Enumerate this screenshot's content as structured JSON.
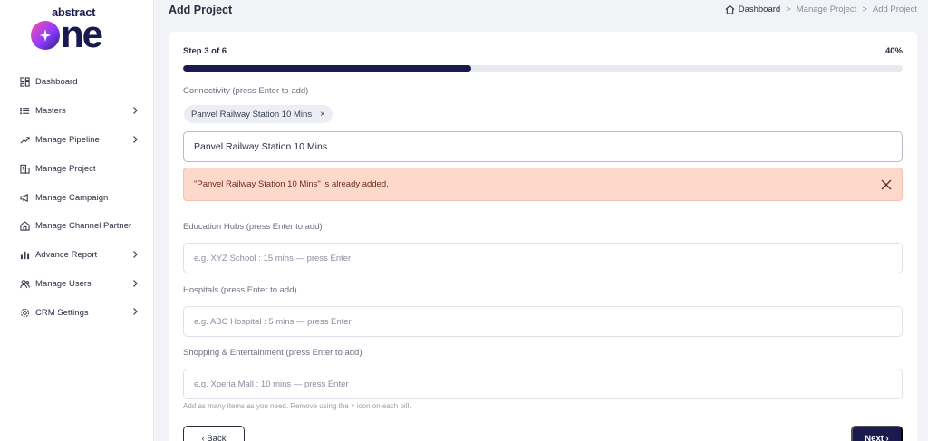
{
  "brand": {
    "top": "abstract",
    "main_o": "o",
    "main_rest": "ne"
  },
  "sidebar": {
    "items": [
      {
        "label": "Dashboard",
        "icon": "grid-icon",
        "has_submenu": false
      },
      {
        "label": "Masters",
        "icon": "list-icon",
        "has_submenu": true
      },
      {
        "label": "Manage Pipeline",
        "icon": "pipeline-icon",
        "has_submenu": true
      },
      {
        "label": "Manage Project",
        "icon": "building-icon",
        "has_submenu": false
      },
      {
        "label": "Manage Campaign",
        "icon": "megaphone-icon",
        "has_submenu": false
      },
      {
        "label": "Manage Channel Partner",
        "icon": "partner-icon",
        "has_submenu": false
      },
      {
        "label": "Advance Report",
        "icon": "bar-chart-icon",
        "has_submenu": true
      },
      {
        "label": "Manage Users",
        "icon": "users-icon",
        "has_submenu": true
      },
      {
        "label": "CRM Settings",
        "icon": "gear-icon",
        "has_submenu": true
      }
    ]
  },
  "header": {
    "title": "Add Project",
    "breadcrumb": [
      "Dashboard",
      "Manage Project",
      "Add Project"
    ],
    "separator": ">"
  },
  "wizard": {
    "step_label": "Step 3 of 6",
    "percent_label": "40%",
    "progress": 0.4
  },
  "connectivity": {
    "label": "Connectivity (press Enter to add)",
    "pills": [
      {
        "text": "Panvel Railway Station 10 Mins",
        "remove": "×"
      }
    ],
    "input_value": "Panvel Railway Station 10 Mins",
    "alert": "\"Panvel Railway Station 10 Mins\" is already added."
  },
  "education": {
    "label": "Education Hubs (press Enter to add)",
    "placeholder": "e.g. XYZ School : 15 mins — press Enter"
  },
  "hospitals": {
    "label": "Hospitals (press Enter to add)",
    "placeholder": "e.g. ABC Hospital : 5 mins — press Enter"
  },
  "shopping": {
    "label": "Shopping & Entertainment (press Enter to add)",
    "placeholder": "e.g. Xperia Mall : 10 mins — press Enter"
  },
  "hint": "Add as many items as you need. Remove using the × icon on each pill.",
  "buttons": {
    "back": "‹ Back",
    "next": "Next ›"
  },
  "colors": {
    "primary": "#1b1a4e",
    "alert_bg": "#fcd9cb",
    "track": "#e9eaf0"
  }
}
